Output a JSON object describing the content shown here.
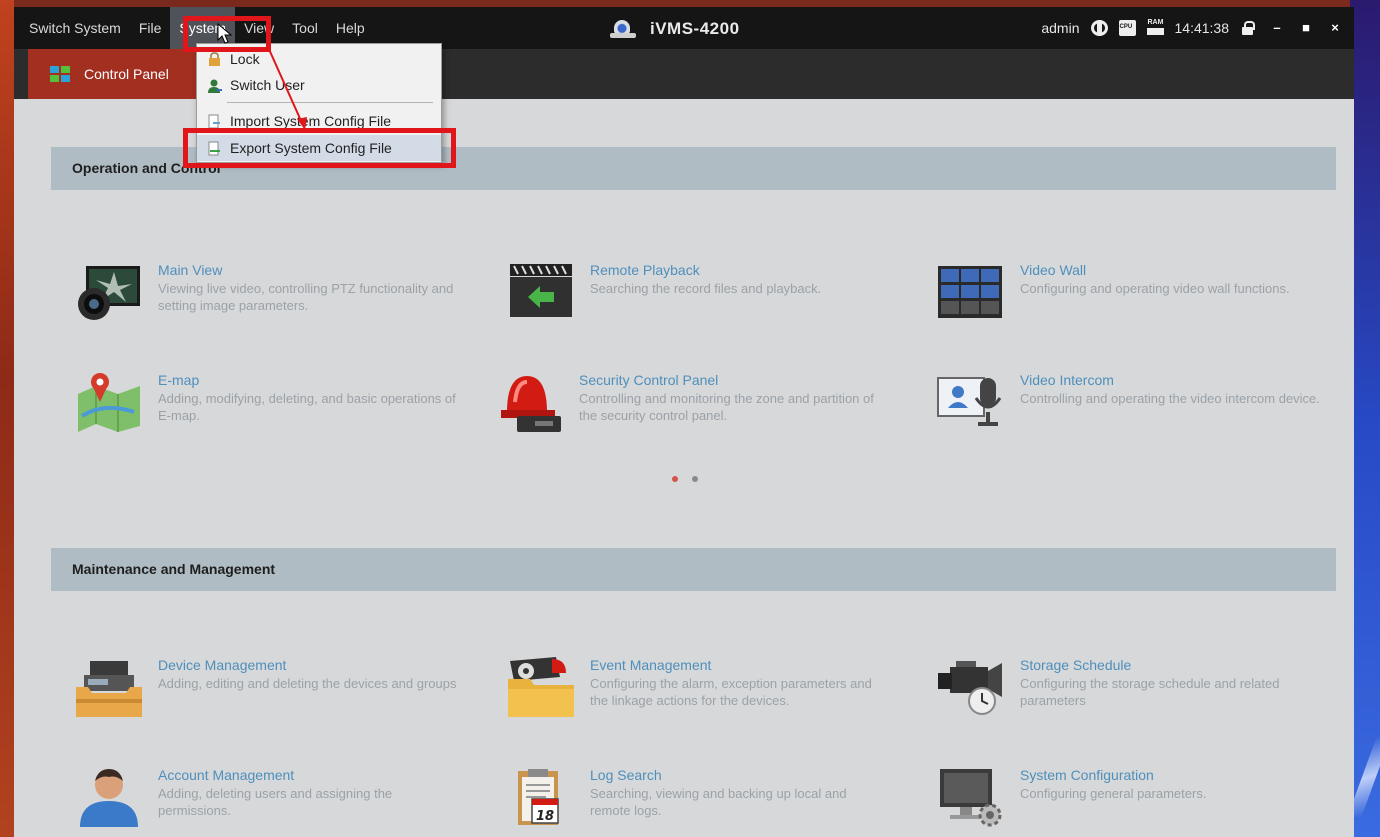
{
  "app": {
    "title": "iVMS-4200"
  },
  "menu": {
    "items": [
      {
        "label": "Switch System"
      },
      {
        "label": "File"
      },
      {
        "label": "System"
      },
      {
        "label": "View"
      },
      {
        "label": "Tool"
      },
      {
        "label": "Help"
      }
    ],
    "active": "System"
  },
  "status": {
    "user": "admin",
    "time": "14:41:38"
  },
  "tab": {
    "label": "Control Panel"
  },
  "dropdown": {
    "items": [
      {
        "label": "Lock",
        "icon": "lock-icon"
      },
      {
        "label": "Switch User",
        "icon": "switch-user-icon"
      },
      {
        "label": "Import System Config File",
        "icon": "import-icon"
      },
      {
        "label": "Export System Config File",
        "icon": "export-icon"
      }
    ],
    "highlighted": "Export System Config File"
  },
  "sections": {
    "operation": {
      "title": "Operation and Control",
      "cards": [
        {
          "title": "Main View",
          "desc": "Viewing live video, controlling PTZ functionality and setting image parameters.",
          "icon": "main-view-icon"
        },
        {
          "title": "Remote Playback",
          "desc": "Searching the record files and playback.",
          "icon": "remote-playback-icon"
        },
        {
          "title": "Video Wall",
          "desc": "Configuring and operating video wall functions.",
          "icon": "video-wall-icon"
        },
        {
          "title": "E-map",
          "desc": "Adding, modifying, deleting, and basic operations of E-map.",
          "icon": "emap-icon"
        },
        {
          "title": "Security Control Panel",
          "desc": "Controlling and monitoring the zone and partition of the security control panel.",
          "icon": "security-panel-icon"
        },
        {
          "title": "Video Intercom",
          "desc": "Controlling and operating the video intercom device.",
          "icon": "video-intercom-icon"
        }
      ]
    },
    "maintenance": {
      "title": "Maintenance and Management",
      "cards": [
        {
          "title": "Device Management",
          "desc": "Adding, editing and deleting the devices and groups",
          "icon": "device-management-icon"
        },
        {
          "title": "Event Management",
          "desc": "Configuring the alarm, exception parameters and the linkage actions for the devices.",
          "icon": "event-management-icon"
        },
        {
          "title": "Storage Schedule",
          "desc": "Configuring the storage schedule and related parameters",
          "icon": "storage-schedule-icon"
        },
        {
          "title": "Account Management",
          "desc": "Adding, deleting users and assigning the permissions.",
          "icon": "account-management-icon"
        },
        {
          "title": "Log Search",
          "desc": "Searching, viewing and backing up local and remote logs.",
          "icon": "log-search-icon",
          "calendar_day": "18"
        },
        {
          "title": "System Configuration",
          "desc": "Configuring general parameters.",
          "icon": "system-configuration-icon"
        }
      ]
    }
  },
  "pagination": {
    "pages": 2,
    "current": 1
  },
  "colors": {
    "accent_tab": "#a32f21",
    "highlight_box": "#e0161b",
    "card_title": "#4f8fbc",
    "dot_active": "#d0554a",
    "dot_inactive": "#8a8a8a"
  }
}
